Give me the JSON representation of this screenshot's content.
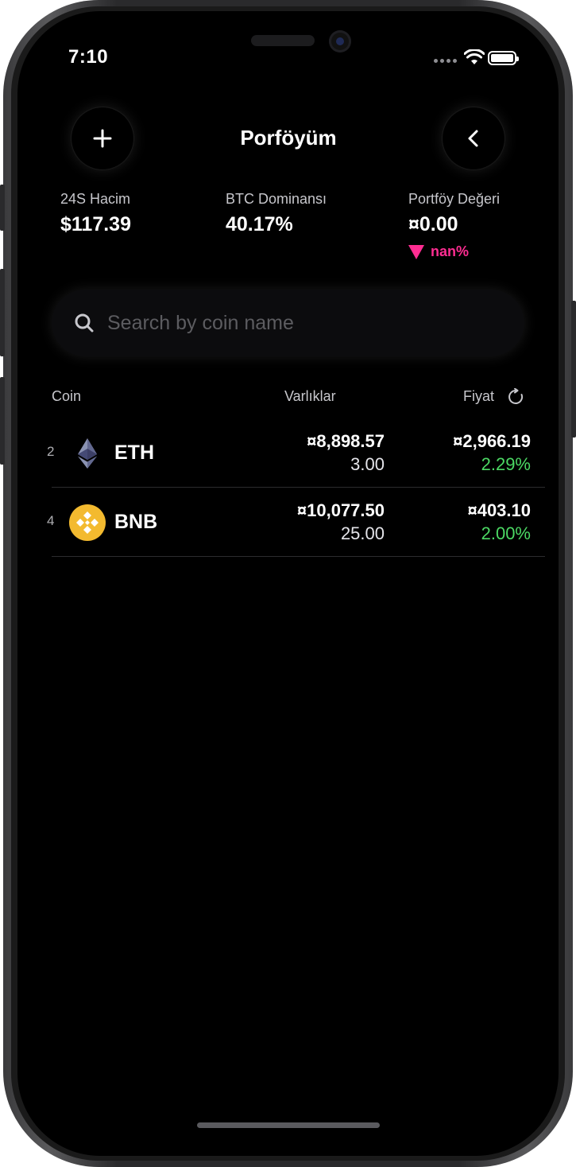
{
  "status_bar": {
    "time": "7:10"
  },
  "header": {
    "title": "Porföyüm",
    "add_icon": "plus-icon",
    "back_icon": "chevron-left-icon"
  },
  "stats": {
    "volume": {
      "label": "24S Hacim",
      "value": "$117.39"
    },
    "dominance": {
      "label": "BTC Dominansı",
      "value": "40.17%"
    },
    "portfolio": {
      "label": "Portföy Değeri",
      "value": "¤0.00",
      "change": "nan%",
      "change_color": "#ff2d92"
    }
  },
  "search": {
    "placeholder": "Search by coin name",
    "value": ""
  },
  "table": {
    "headers": {
      "coin": "Coin",
      "holdings": "Varlıklar",
      "price": "Fiyat"
    },
    "refresh_icon": "refresh-icon",
    "rows": [
      {
        "rank": "2",
        "symbol": "ETH",
        "icon": "ethereum-icon",
        "holding_value": "¤8,898.57",
        "holding_qty": "3.00",
        "price": "¤2,966.19",
        "change": "2.29%"
      },
      {
        "rank": "4",
        "symbol": "BNB",
        "icon": "binance-coin-icon",
        "holding_value": "¤10,077.50",
        "holding_qty": "25.00",
        "price": "¤403.10",
        "change": "2.00%"
      }
    ]
  },
  "colors": {
    "positive": "#4cd964",
    "negative": "#ff2d92",
    "bnb": "#f3ba2f"
  }
}
